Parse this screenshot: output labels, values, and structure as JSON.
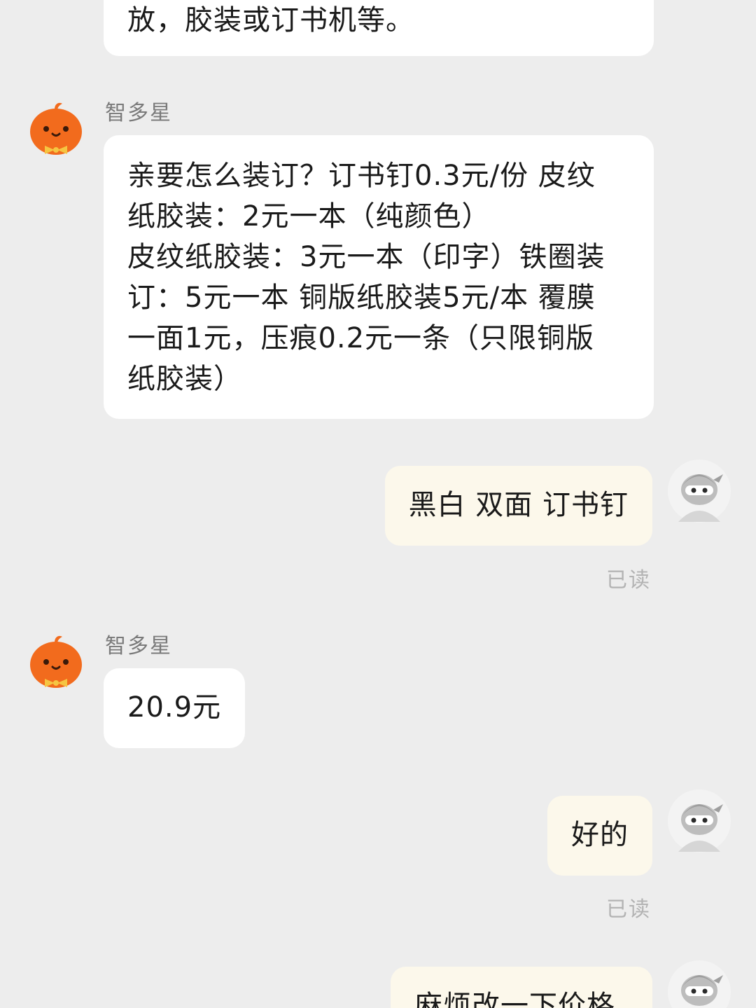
{
  "messages": [
    {
      "from": "bot",
      "text": "放，胶装或订书机等。"
    },
    {
      "from": "bot",
      "sender": "智多星",
      "avatar_icon": "pumpkin-avatar-icon",
      "text": "亲要怎么装订？订书钉0.3元/份 皮纹\n纸胶装：2元一本（纯颜色）\n皮纹纸胶装：3元一本（印字）铁圈装\n订：5元一本 铜版纸胶装5元/本 覆膜\n一面1元，压痕0.2元一条（只限铜版\n纸胶装）"
    },
    {
      "from": "user",
      "avatar_icon": "ninja-avatar-icon",
      "text": "黑白 双面 订书钉",
      "status": "已读"
    },
    {
      "from": "bot",
      "sender": "智多星",
      "avatar_icon": "pumpkin-avatar-icon",
      "text": "20.9元"
    },
    {
      "from": "user",
      "avatar_icon": "ninja-avatar-icon",
      "text": "好的",
      "status": "已读"
    },
    {
      "from": "user",
      "avatar_icon": "ninja-avatar-icon",
      "text": "麻烦改一下价格"
    }
  ],
  "colors": {
    "background": "#EDEDED",
    "incoming_bubble": "#FFFFFF",
    "outgoing_bubble": "#FCF8EB",
    "sender_name": "#7A7A7A",
    "read_status": "#B3B3B3",
    "bot_avatar": "#F26B1D"
  }
}
